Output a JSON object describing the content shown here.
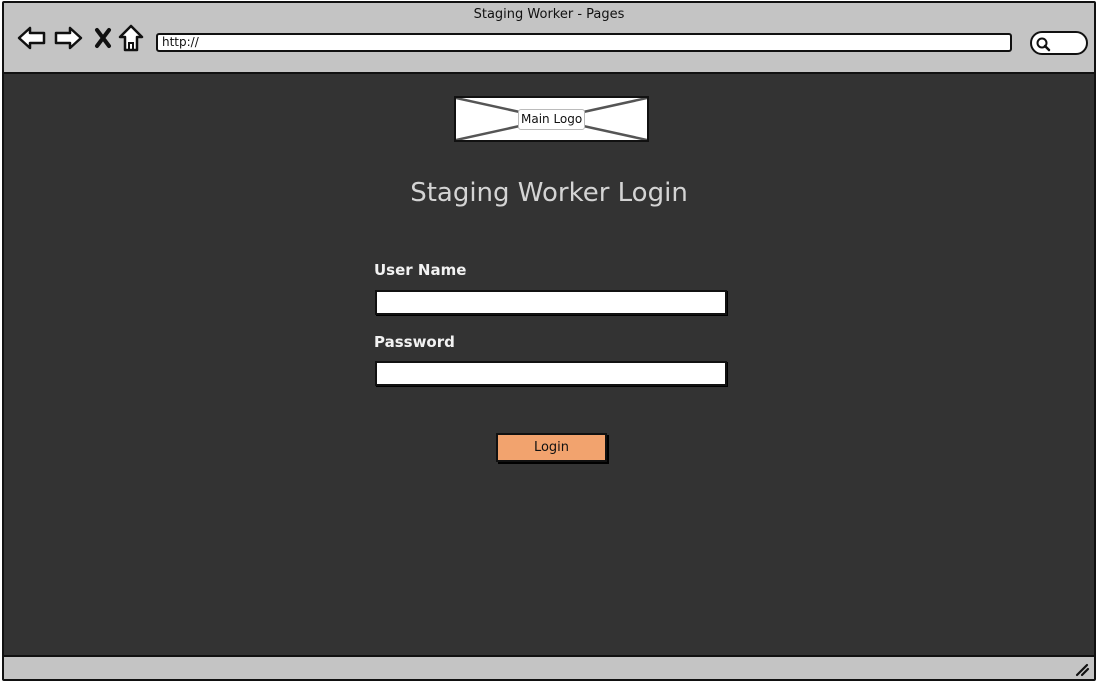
{
  "window": {
    "title": "Staging Worker - Pages",
    "url": "http://"
  },
  "toolbar": {
    "back_icon": "back-arrow-icon",
    "forward_icon": "forward-arrow-icon",
    "stop_icon": "close-icon",
    "home_icon": "home-icon",
    "search_icon": "search-icon"
  },
  "page": {
    "logo_label": "Main Logo",
    "heading": "Staging Worker Login",
    "username_label": "User Name",
    "username_value": "",
    "password_label": "Password",
    "password_value": "",
    "login_label": "Login"
  },
  "colors": {
    "page_background": "#333333",
    "chrome": "#c4c4c4",
    "login_button": "#f2a36e",
    "heading_text": "#d4d4d4"
  }
}
